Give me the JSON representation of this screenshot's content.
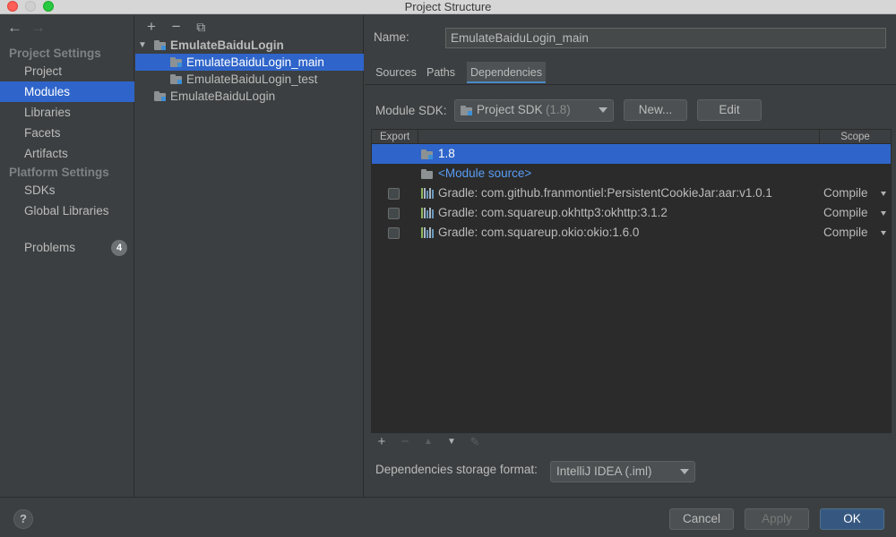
{
  "window": {
    "title": "Project Structure"
  },
  "nav": {
    "back": "←",
    "forward": "→"
  },
  "sidebar": {
    "project_settings_label": "Project Settings",
    "platform_settings_label": "Platform Settings",
    "items": [
      {
        "label": "Project"
      },
      {
        "label": "Modules"
      },
      {
        "label": "Libraries"
      },
      {
        "label": "Facets"
      },
      {
        "label": "Artifacts"
      },
      {
        "label": "SDKs"
      },
      {
        "label": "Global Libraries"
      },
      {
        "label": "Problems",
        "badge": "4"
      }
    ]
  },
  "tree": {
    "toolbar": {
      "add": "+",
      "remove": "−",
      "copy": "⧉"
    },
    "nodes": [
      {
        "label": "EmulateBaiduLogin"
      },
      {
        "label": "EmulateBaiduLogin_main"
      },
      {
        "label": "EmulateBaiduLogin_test"
      },
      {
        "label": "EmulateBaiduLogin"
      }
    ]
  },
  "main": {
    "name_label": "Name:",
    "name_value": "EmulateBaiduLogin_main",
    "tabs": [
      {
        "label": "Sources"
      },
      {
        "label": "Paths"
      },
      {
        "label": "Dependencies"
      }
    ],
    "module_sdk_label": "Module SDK:",
    "sdk_combo": {
      "name": "Project SDK",
      "version": "(1.8)"
    },
    "new_button": "New...",
    "edit_button": "Edit",
    "table": {
      "headers": {
        "export": "Export",
        "scope": "Scope"
      },
      "rows": [
        {
          "label": "1.8",
          "scope": ""
        },
        {
          "label": "<Module source>",
          "scope": ""
        },
        {
          "label": "Gradle: com.github.franmontiel:PersistentCookieJar:aar:v1.0.1",
          "scope": "Compile"
        },
        {
          "label": "Gradle: com.squareup.okhttp3:okhttp:3.1.2",
          "scope": "Compile"
        },
        {
          "label": "Gradle: com.squareup.okio:okio:1.6.0",
          "scope": "Compile"
        }
      ]
    },
    "table_toolbar": {
      "add": "+",
      "remove": "−",
      "up": "▲",
      "down": "▼",
      "edit": "✎"
    },
    "storage_label": "Dependencies storage format:",
    "storage_value": "IntelliJ IDEA (.iml)"
  },
  "footer": {
    "help": "?",
    "cancel": "Cancel",
    "apply": "Apply",
    "ok": "OK"
  },
  "colors": {
    "selection": "#2f65ca",
    "link": "#589df6",
    "primary_button": "#365880"
  }
}
